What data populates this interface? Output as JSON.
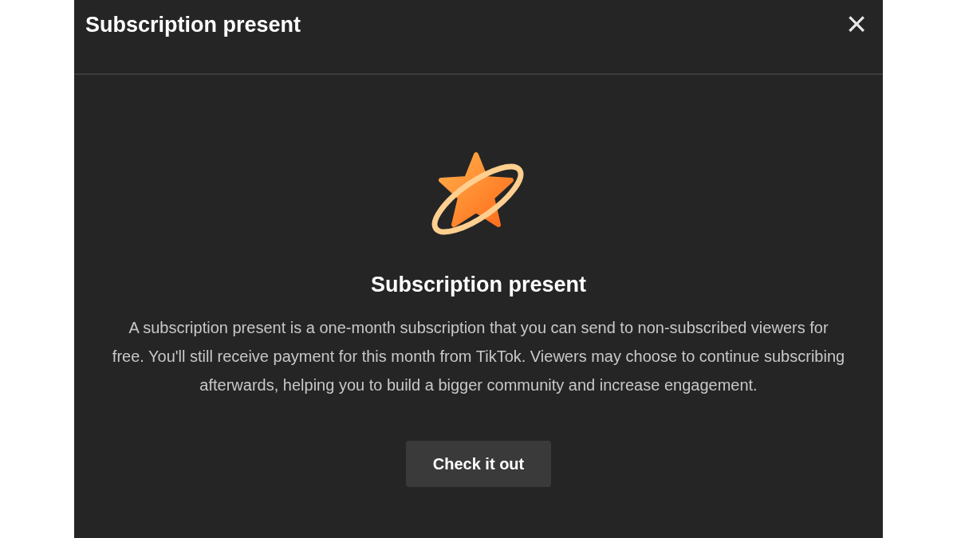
{
  "dialog": {
    "title": "Subscription present",
    "close": "×"
  },
  "content": {
    "heading": "Subscription present",
    "body": "A subscription present is a one-month subscription that you can send to non-subscribed viewers for free. You'll still receive payment for this month from TikTok. Viewers may choose to continue subscribing afterwards, helping you to build a bigger community and increase engagement."
  },
  "buttons": [
    "Check it out"
  ]
}
